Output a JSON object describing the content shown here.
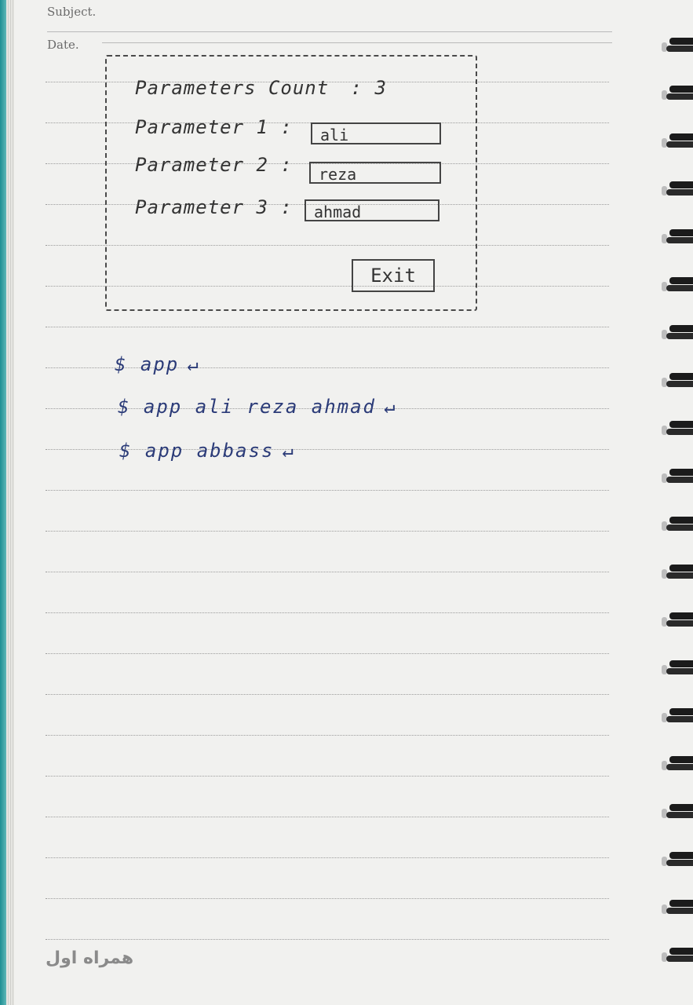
{
  "notebook": {
    "subject_label": "Subject.",
    "date_label": "Date.",
    "brand_logo_text": "همراه اول"
  },
  "sketch": {
    "parameters_count_label": "Parameters Count",
    "parameters_count_value": ": 3",
    "rows": [
      {
        "label": "Parameter 1 :",
        "value": "ali"
      },
      {
        "label": "Parameter 2 :",
        "value": "reza"
      },
      {
        "label": "Parameter 3 :",
        "value": "ahmad"
      }
    ],
    "exit_label": "Exit"
  },
  "commands": [
    {
      "text": "$ app",
      "enter_icon": "↵"
    },
    {
      "text": "$ app ali reza ahmad",
      "enter_icon": "↵"
    },
    {
      "text": "$ app abbass",
      "enter_icon": "↵"
    }
  ],
  "colors": {
    "ink_pencil": "#333333",
    "ink_blue": "#2b3b78",
    "paper": "#f1f1ef",
    "teal_edge": "#1d8f93"
  }
}
